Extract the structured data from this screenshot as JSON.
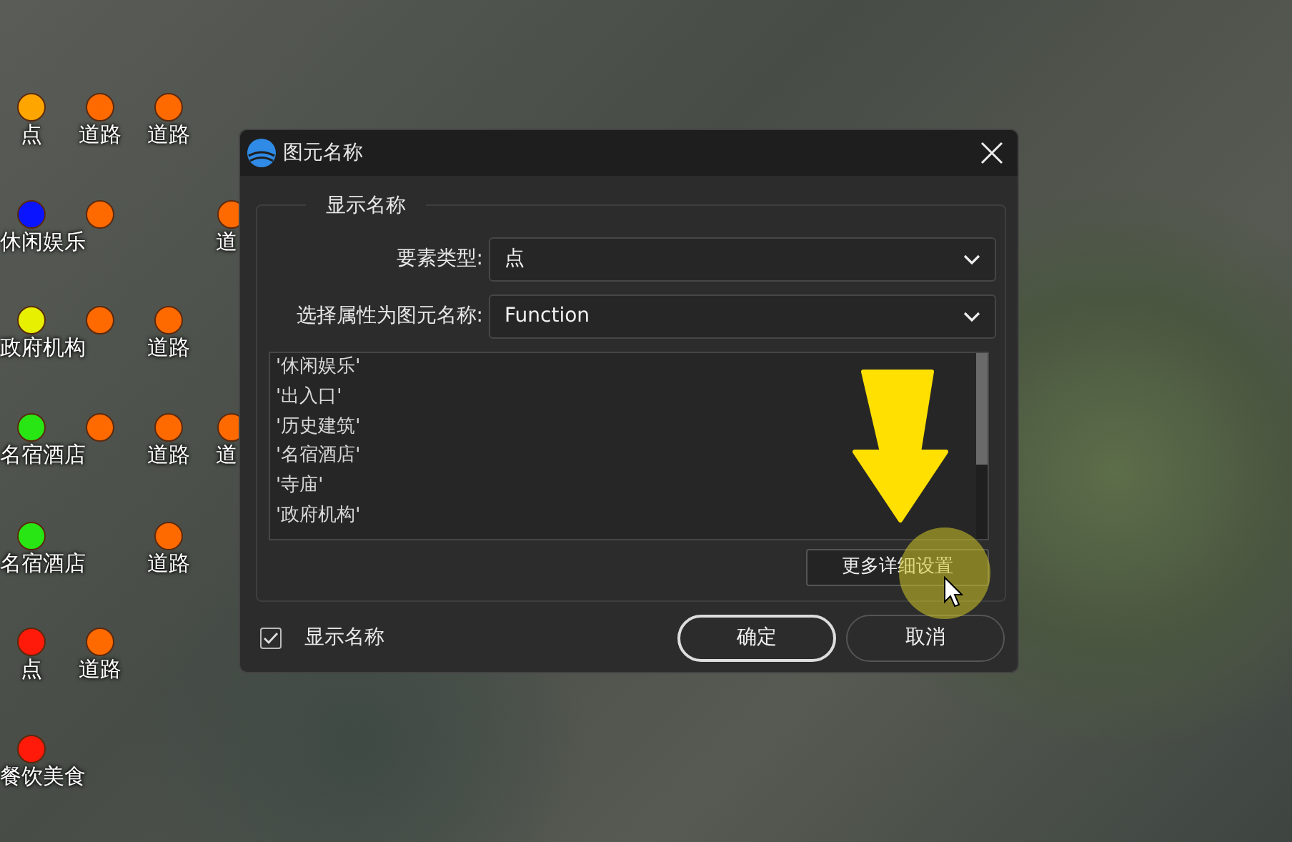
{
  "map": {
    "points": [
      {
        "color": "#ffa500",
        "label": "点"
      },
      {
        "color": "#ff6a00",
        "label": "道路"
      },
      {
        "color": "#ff6a00",
        "label": "道路"
      },
      {
        "color": "#0a14ff",
        "label": "休闲娱乐"
      },
      {
        "color": "#ff6a00"
      },
      {
        "color": "#ff6a00",
        "label": "道"
      },
      {
        "color": "#e6f000",
        "label": "政府机构"
      },
      {
        "color": "#ff6a00"
      },
      {
        "color": "#ff6a00",
        "label": "道路"
      },
      {
        "color": "#28e614",
        "label": "名宿酒店"
      },
      {
        "color": "#ff6a00"
      },
      {
        "color": "#ff6a00",
        "label": "道路"
      },
      {
        "color": "#ff6a00",
        "label": "道"
      },
      {
        "color": "#28e614",
        "label": "名宿酒店"
      },
      {
        "color": "#ff6a00",
        "label": "道路"
      },
      {
        "color": "#ff1a0a",
        "label": "点"
      },
      {
        "color": "#ff6a00",
        "label": "道路"
      },
      {
        "color": "#ff1a0a",
        "label": "餐饮美食"
      }
    ]
  },
  "dialog": {
    "title": "图元名称",
    "group_title": "显示名称",
    "fields": [
      {
        "label": "要素类型:",
        "value": "点"
      },
      {
        "label": "选择属性为图元名称:",
        "value": "Function"
      }
    ],
    "values_list": [
      "'休闲娱乐'",
      "'出入口'",
      "'历史建筑'",
      "'名宿酒店'",
      "'寺庙'",
      "'政府机构'"
    ],
    "more_button": "更多详细设置",
    "show_name_checkbox": {
      "label": "显示名称",
      "checked": true
    },
    "buttons": [
      {
        "label": "确定",
        "default": true
      },
      {
        "label": "取消",
        "default": false
      }
    ]
  }
}
